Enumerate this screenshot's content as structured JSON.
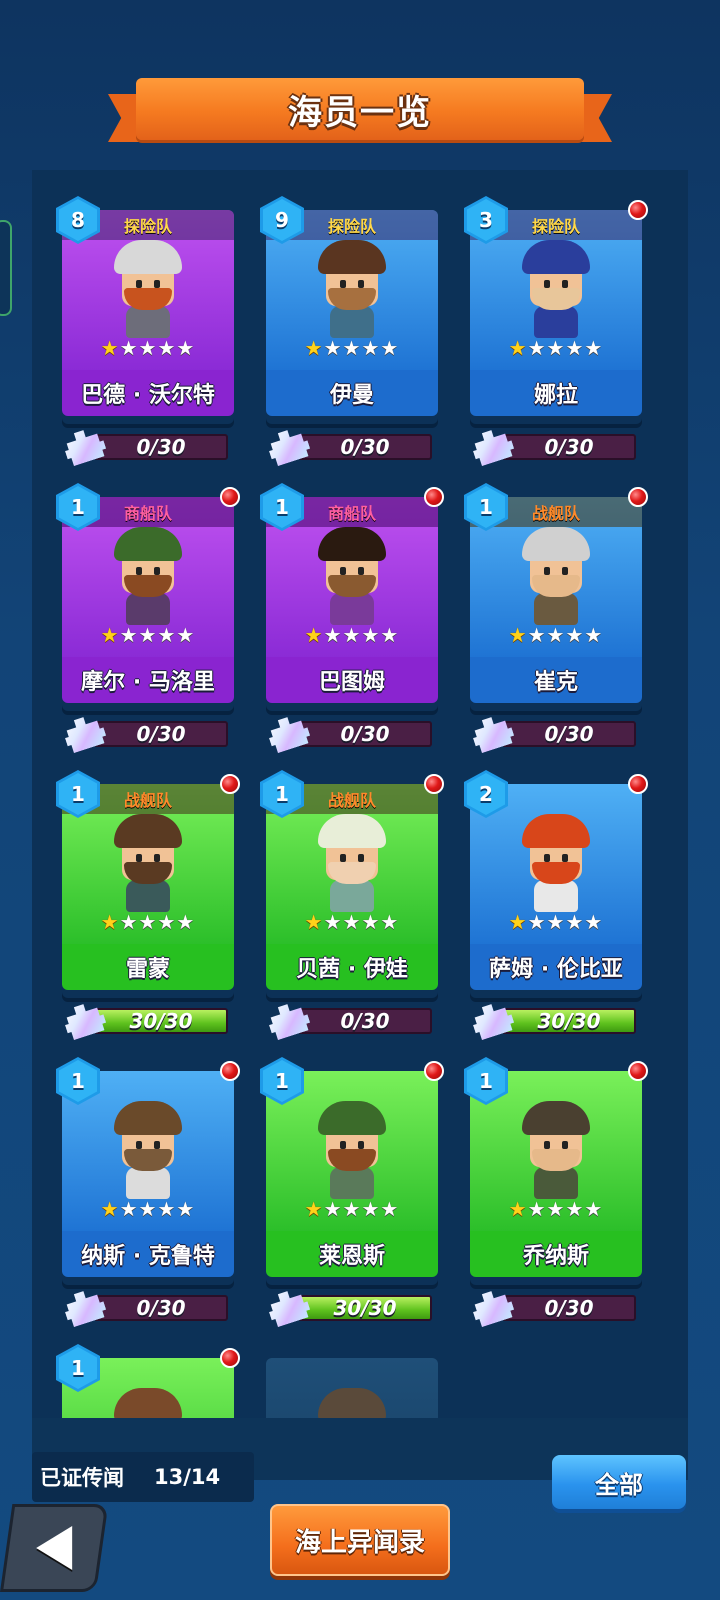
{
  "title": "海员一览",
  "crew": [
    {
      "level": "8",
      "faction": "探险队",
      "faction_type": "expl",
      "name": "巴德 · 沃尔特",
      "stars": 1,
      "progress_text": "0/30",
      "progress": 0.0,
      "color": "purple",
      "badge": false,
      "hat": "#d8d8d8",
      "beard": "#c8531e",
      "body": "#6d6d7a"
    },
    {
      "level": "9",
      "faction": "探险队",
      "faction_type": "expl",
      "name": "伊曼",
      "stars": 1,
      "progress_text": "0/30",
      "progress": 0.0,
      "color": "blue",
      "badge": false,
      "hat": "#5a3520",
      "beard": "#a7703f",
      "body": "#3f6f8a"
    },
    {
      "level": "3",
      "faction": "探险队",
      "faction_type": "expl",
      "name": "娜拉",
      "stars": 1,
      "progress_text": "0/30",
      "progress": 0.0,
      "color": "blue",
      "badge": true,
      "hat": "#2a3e9c",
      "beard": "#e8c69a",
      "body": "#2a3e9c"
    },
    {
      "level": "1",
      "faction": "商船队",
      "faction_type": "merc",
      "name": "摩尔 · 马洛里",
      "stars": 1,
      "progress_text": "0/30",
      "progress": 0.0,
      "color": "purple",
      "badge": true,
      "hat": "#3b6b2a",
      "beard": "#8a4a22",
      "body": "#5a3b6b"
    },
    {
      "level": "1",
      "faction": "商船队",
      "faction_type": "merc",
      "name": "巴图姆",
      "stars": 1,
      "progress_text": "0/30",
      "progress": 0.0,
      "color": "purple",
      "badge": true,
      "hat": "#2a1a10",
      "beard": "#8a5a30",
      "body": "#7a3a9a"
    },
    {
      "level": "1",
      "faction": "战舰队",
      "faction_type": "war",
      "name": "崔克",
      "stars": 1,
      "progress_text": "0/30",
      "progress": 0.0,
      "color": "blue",
      "badge": true,
      "hat": "#d0d0d0",
      "beard": "#e6b98a",
      "body": "#6a5a40"
    },
    {
      "level": "1",
      "faction": "战舰队",
      "faction_type": "war",
      "name": "雷蒙",
      "stars": 1,
      "progress_text": "30/30",
      "progress": 1.0,
      "color": "green",
      "badge": true,
      "hat": "#5a3a22",
      "beard": "#5a3a22",
      "body": "#3a5a5a"
    },
    {
      "level": "1",
      "faction": "战舰队",
      "faction_type": "war",
      "name": "贝茜 · 伊娃",
      "stars": 1,
      "progress_text": "0/30",
      "progress": 0.0,
      "color": "green",
      "badge": true,
      "hat": "#e8eed8",
      "beard": "#f0d0b0",
      "body": "#7aa89a"
    },
    {
      "level": "2",
      "faction": "",
      "faction_type": "",
      "name": "萨姆 · 伦比亚",
      "stars": 1,
      "progress_text": "30/30",
      "progress": 1.0,
      "color": "blue",
      "badge": true,
      "hat": "#d8461a",
      "beard": "#d8461a",
      "body": "#e8e8e8"
    },
    {
      "level": "1",
      "faction": "",
      "faction_type": "",
      "name": "纳斯 · 克鲁特",
      "stars": 1,
      "progress_text": "0/30",
      "progress": 0.0,
      "color": "blue",
      "badge": true,
      "hat": "#6a4a2a",
      "beard": "#7a5a3a",
      "body": "#dcdcdc"
    },
    {
      "level": "1",
      "faction": "",
      "faction_type": "",
      "name": "莱恩斯",
      "stars": 1,
      "progress_text": "30/30",
      "progress": 1.0,
      "color": "green",
      "badge": true,
      "hat": "#3b6b2a",
      "beard": "#8a4a22",
      "body": "#5a7a5a"
    },
    {
      "level": "1",
      "faction": "",
      "faction_type": "",
      "name": "乔纳斯",
      "stars": 1,
      "progress_text": "0/30",
      "progress": 0.0,
      "color": "green",
      "badge": true,
      "hat": "#4a4030",
      "beard": "#e6b98a",
      "body": "#4a5a3a"
    },
    {
      "level": "1",
      "faction": "",
      "faction_type": "",
      "name": "",
      "stars": 0,
      "progress_text": "",
      "progress": 0.0,
      "color": "green",
      "badge": true,
      "hat": "#7a4a2a",
      "beard": "#7a4a2a",
      "body": "#7a4a2a"
    },
    {
      "level": "",
      "faction": "",
      "faction_type": "",
      "name": "",
      "stars": 0,
      "progress_text": "",
      "progress": 0.0,
      "color": "dark",
      "badge": false,
      "hat": "#5a4a3a",
      "beard": "#5a4a3a",
      "body": "#5a4a3a"
    }
  ],
  "footer": {
    "proven_label": "已证传闻",
    "proven_count": "13/14",
    "all_button": "全部",
    "log_button": "海上异闻录"
  }
}
